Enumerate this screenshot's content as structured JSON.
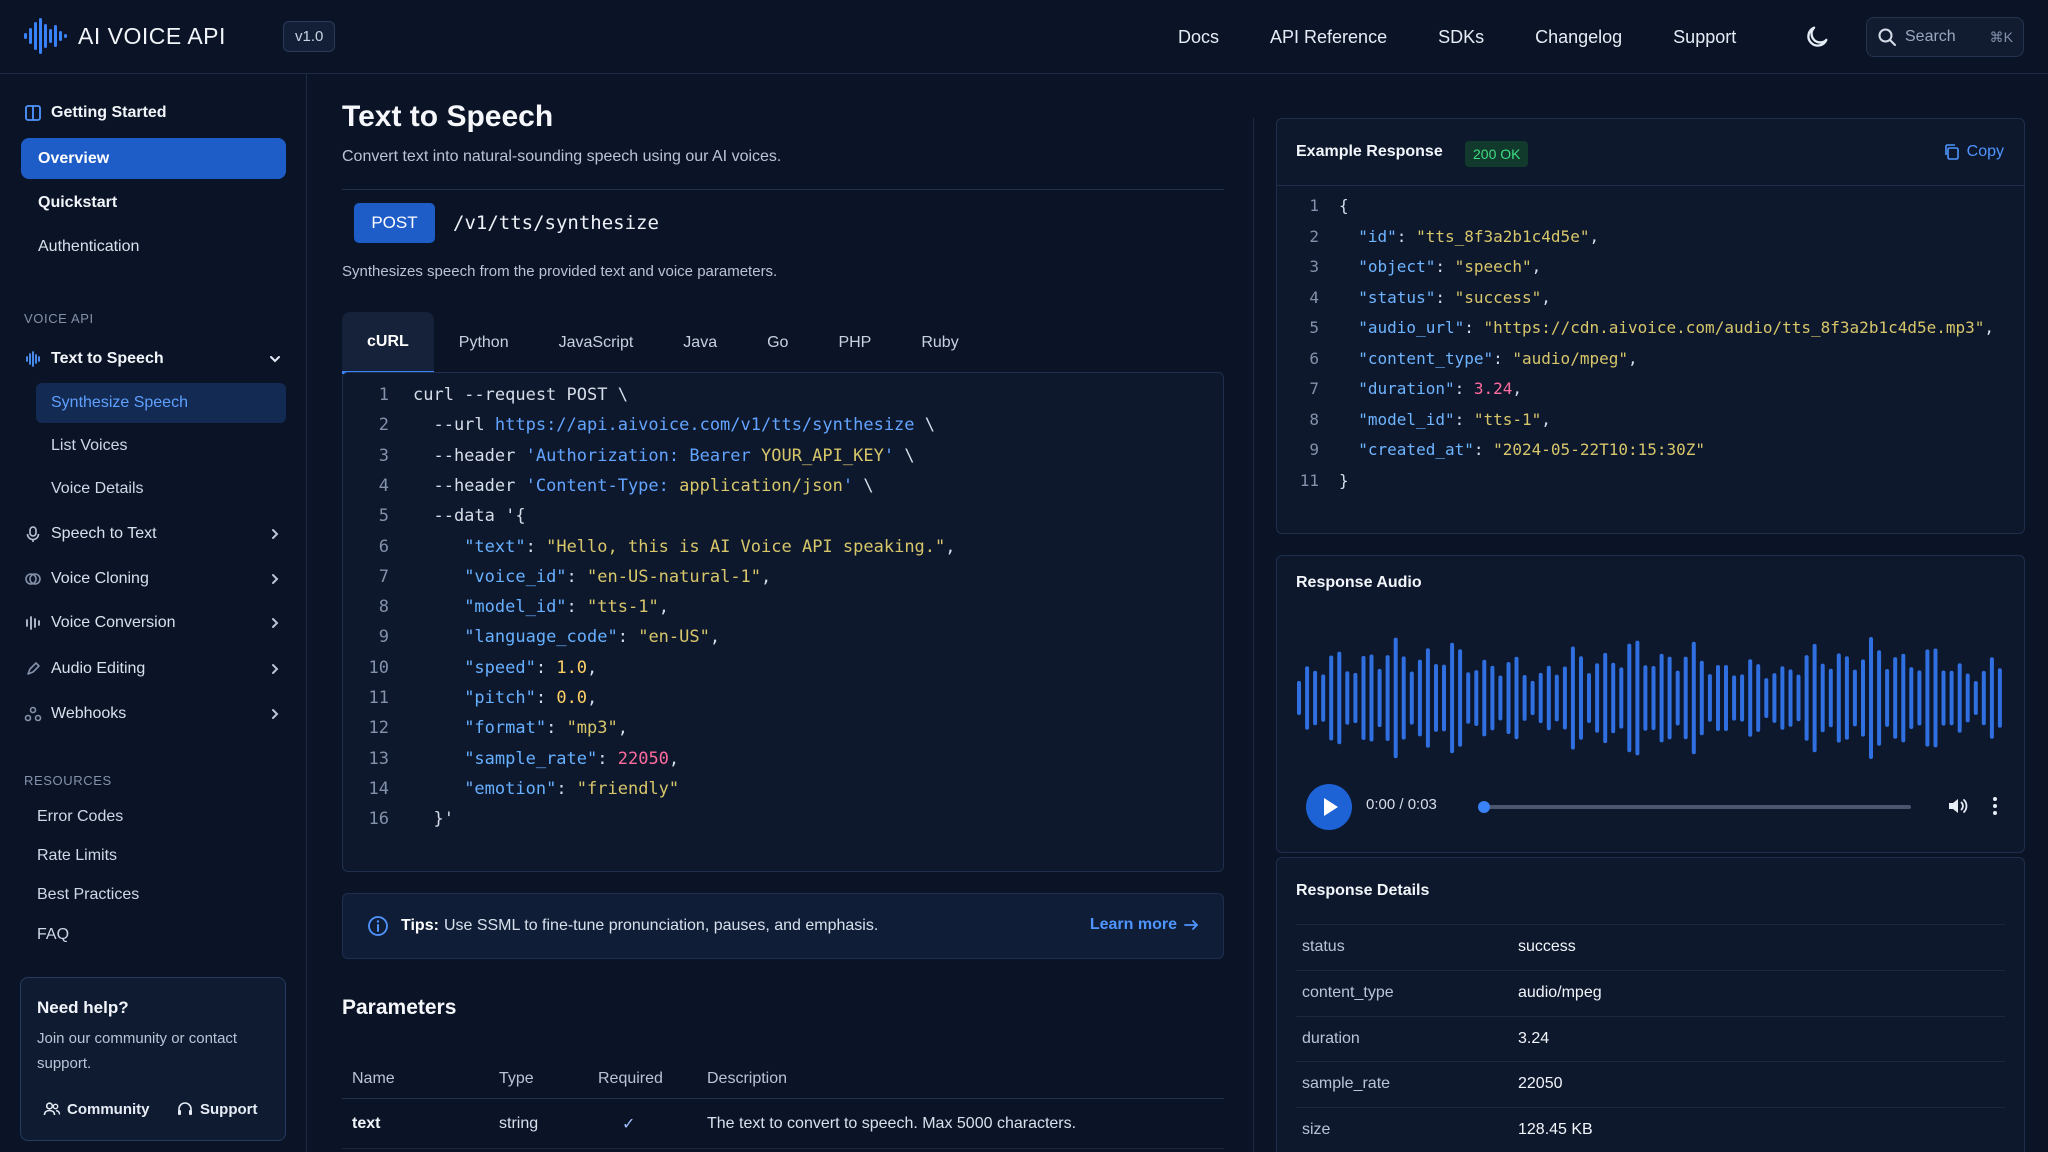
{
  "app": {
    "name": "AI VOICE API",
    "version": "v1.0"
  },
  "topnav": {
    "items": [
      "Docs",
      "API Reference",
      "SDKs",
      "Changelog",
      "Support"
    ],
    "search_placeholder": "Search",
    "search_shortcut": "⌘K"
  },
  "sidebar": {
    "getting_started": "Getting Started",
    "gs_items": [
      "Overview",
      "Quickstart",
      "Authentication"
    ],
    "voice_api_label": "VOICE API",
    "groups": [
      "Text to Speech",
      "Speech to Text",
      "Voice Cloning",
      "Voice Conversion",
      "Audio Editing",
      "Webhooks"
    ],
    "tts_items": [
      "Synthesize Speech",
      "List Voices",
      "Voice Details"
    ],
    "resources_label": "RESOURCES",
    "resources": [
      "Error Codes",
      "Rate Limits",
      "Best Practices",
      "FAQ"
    ],
    "help": {
      "title": "Need help?",
      "text": "Join our community or contact support.",
      "community": "Community",
      "support": "Support"
    }
  },
  "main": {
    "title": "Text to Speech",
    "subtitle": "Convert text into natural-sounding speech using our AI voices.",
    "method": "POST",
    "endpoint": "/v1/tts/synthesize",
    "endpoint_desc": "Synthesizes speech from the provided text and voice parameters.",
    "tabs": [
      "cURL",
      "Python",
      "JavaScript",
      "Java",
      "Go",
      "PHP",
      "Ruby"
    ],
    "active_tab": "cURL",
    "code_lines": [
      {
        "n": "1",
        "parts": [
          [
            "c-plain",
            "curl --request POST \\"
          ]
        ]
      },
      {
        "n": "2",
        "parts": [
          [
            "c-plain",
            "  --url "
          ],
          [
            "c-url",
            "https://api.aivoice.com/v1/tts/synthesize"
          ],
          [
            "c-plain",
            " \\"
          ]
        ]
      },
      {
        "n": "3",
        "parts": [
          [
            "c-plain",
            "  --header "
          ],
          [
            "c-url",
            "'Authorization: Bearer "
          ],
          [
            "c-str",
            "YOUR_API_KEY"
          ],
          [
            "c-url",
            "'"
          ],
          [
            "c-plain",
            " \\"
          ]
        ]
      },
      {
        "n": "4",
        "parts": [
          [
            "c-plain",
            "  --header "
          ],
          [
            "c-url",
            "'Content-Type: "
          ],
          [
            "c-str",
            "application/json"
          ],
          [
            "c-url",
            "'"
          ],
          [
            "c-plain",
            " \\"
          ]
        ]
      },
      {
        "n": "5",
        "parts": [
          [
            "c-plain",
            "  --data '{"
          ]
        ]
      },
      {
        "n": "6",
        "parts": [
          [
            "c-plain",
            "     "
          ],
          [
            "c-key",
            "\"text\""
          ],
          [
            "c-plain",
            ": "
          ],
          [
            "c-str",
            "\"Hello, this is AI Voice API speaking.\""
          ],
          [
            "c-plain",
            ","
          ]
        ]
      },
      {
        "n": "7",
        "parts": [
          [
            "c-plain",
            "     "
          ],
          [
            "c-key",
            "\"voice_id\""
          ],
          [
            "c-plain",
            ": "
          ],
          [
            "c-str",
            "\"en-US-natural-1\""
          ],
          [
            "c-plain",
            ","
          ]
        ]
      },
      {
        "n": "8",
        "parts": [
          [
            "c-plain",
            "     "
          ],
          [
            "c-key",
            "\"model_id\""
          ],
          [
            "c-plain",
            ": "
          ],
          [
            "c-str",
            "\"tts-1\""
          ],
          [
            "c-plain",
            ","
          ]
        ]
      },
      {
        "n": "9",
        "parts": [
          [
            "c-plain",
            "     "
          ],
          [
            "c-key",
            "\"language_code\""
          ],
          [
            "c-plain",
            ": "
          ],
          [
            "c-str",
            "\"en-US\""
          ],
          [
            "c-plain",
            ","
          ]
        ]
      },
      {
        "n": "10",
        "parts": [
          [
            "c-plain",
            "     "
          ],
          [
            "c-key",
            "\"speed\""
          ],
          [
            "c-plain",
            ": "
          ],
          [
            "c-num",
            "1.0"
          ],
          [
            "c-plain",
            ","
          ]
        ]
      },
      {
        "n": "11",
        "parts": [
          [
            "c-plain",
            "     "
          ],
          [
            "c-key",
            "\"pitch\""
          ],
          [
            "c-plain",
            ": "
          ],
          [
            "c-num",
            "0.0"
          ],
          [
            "c-plain",
            ","
          ]
        ]
      },
      {
        "n": "12",
        "parts": [
          [
            "c-plain",
            "     "
          ],
          [
            "c-key",
            "\"format\""
          ],
          [
            "c-plain",
            ": "
          ],
          [
            "c-str",
            "\"mp3\""
          ],
          [
            "c-plain",
            ","
          ]
        ]
      },
      {
        "n": "13",
        "parts": [
          [
            "c-plain",
            "     "
          ],
          [
            "c-key",
            "\"sample_rate\""
          ],
          [
            "c-plain",
            ": "
          ],
          [
            "c-pink",
            "22050"
          ],
          [
            "c-plain",
            ","
          ]
        ]
      },
      {
        "n": "14",
        "parts": [
          [
            "c-plain",
            "     "
          ],
          [
            "c-key",
            "\"emotion\""
          ],
          [
            "c-plain",
            ": "
          ],
          [
            "c-str",
            "\"friendly\""
          ]
        ]
      },
      {
        "n": "16",
        "parts": [
          [
            "c-plain",
            "  }'"
          ]
        ]
      }
    ],
    "tip_label": "Tips:",
    "tip_text": "Use SSML to fine-tune pronunciation, pauses, and emphasis.",
    "tip_link": "Learn more",
    "params_title": "Parameters",
    "params_headers": [
      "Name",
      "Type",
      "Required",
      "Description"
    ],
    "params_rows": [
      {
        "name": "text",
        "type": "string",
        "required": "✓",
        "description": "The text to convert to speech. Max 5000 characters."
      }
    ]
  },
  "example_response": {
    "title": "Example Response",
    "status_badge": "200 OK",
    "copy_label": "Copy",
    "lines": [
      {
        "n": "1",
        "parts": [
          [
            "j-plain",
            "{"
          ]
        ]
      },
      {
        "n": "2",
        "parts": [
          [
            "j-plain",
            "  "
          ],
          [
            "j-key",
            "\"id\""
          ],
          [
            "j-plain",
            ": "
          ],
          [
            "j-str",
            "\"tts_8f3a2b1c4d5e\""
          ],
          [
            "j-plain",
            ","
          ]
        ]
      },
      {
        "n": "3",
        "parts": [
          [
            "j-plain",
            "  "
          ],
          [
            "j-key",
            "\"object\""
          ],
          [
            "j-plain",
            ": "
          ],
          [
            "j-str",
            "\"speech\""
          ],
          [
            "j-plain",
            ","
          ]
        ]
      },
      {
        "n": "4",
        "parts": [
          [
            "j-plain",
            "  "
          ],
          [
            "j-key",
            "\"status\""
          ],
          [
            "j-plain",
            ": "
          ],
          [
            "j-str",
            "\"success\""
          ],
          [
            "j-plain",
            ","
          ]
        ]
      },
      {
        "n": "5",
        "parts": [
          [
            "j-plain",
            "  "
          ],
          [
            "j-key",
            "\"audio_url\""
          ],
          [
            "j-plain",
            ": "
          ],
          [
            "j-str",
            "\"https://cdn.aivoice.com/audio/tts_8f3a2b1c4d5e.mp3\""
          ],
          [
            "j-plain",
            ","
          ]
        ]
      },
      {
        "n": "6",
        "parts": [
          [
            "j-plain",
            "  "
          ],
          [
            "j-key",
            "\"content_type\""
          ],
          [
            "j-plain",
            ": "
          ],
          [
            "j-str",
            "\"audio/mpeg\""
          ],
          [
            "j-plain",
            ","
          ]
        ]
      },
      {
        "n": "7",
        "parts": [
          [
            "j-plain",
            "  "
          ],
          [
            "j-key",
            "\"duration\""
          ],
          [
            "j-plain",
            ": "
          ],
          [
            "j-num",
            "3.24"
          ],
          [
            "j-plain",
            ","
          ]
        ]
      },
      {
        "n": "8",
        "parts": [
          [
            "j-plain",
            "  "
          ],
          [
            "j-key",
            "\"model_id\""
          ],
          [
            "j-plain",
            ": "
          ],
          [
            "j-str",
            "\"tts-1\""
          ],
          [
            "j-plain",
            ","
          ]
        ]
      },
      {
        "n": "9",
        "parts": [
          [
            "j-plain",
            "  "
          ],
          [
            "j-key",
            "\"created_at\""
          ],
          [
            "j-plain",
            ": "
          ],
          [
            "j-str",
            "\"2024-05-22T10:15:30Z\""
          ]
        ]
      },
      {
        "n": "11",
        "parts": [
          [
            "j-plain",
            "}"
          ]
        ]
      }
    ]
  },
  "response_audio": {
    "title": "Response Audio",
    "time": "0:00 / 0:03",
    "progress": 0
  },
  "response_details": {
    "title": "Response Details",
    "rows": [
      {
        "key": "status",
        "value": "success"
      },
      {
        "key": "content_type",
        "value": "audio/mpeg"
      },
      {
        "key": "duration",
        "value": "3.24"
      },
      {
        "key": "sample_rate",
        "value": "22050"
      },
      {
        "key": "size",
        "value": "128.45 KB"
      }
    ]
  },
  "colors": {
    "accent": "#1e5cc8",
    "link": "#4f95ff",
    "success": "#3ddc84",
    "waveform": "#2f6fe0"
  }
}
